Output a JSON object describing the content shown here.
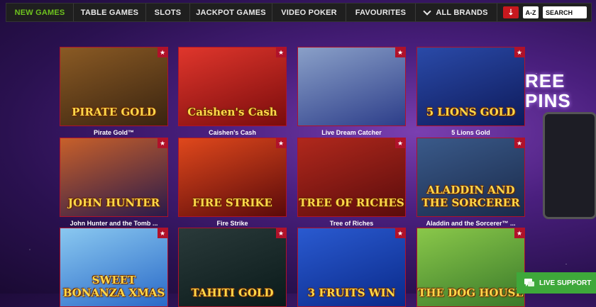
{
  "nav": {
    "items": [
      {
        "label": "NEW GAMES",
        "active": true
      },
      {
        "label": "TABLE GAMES",
        "active": false
      },
      {
        "label": "SLOTS",
        "active": false
      },
      {
        "label": "JACKPOT GAMES",
        "active": false
      },
      {
        "label": "VIDEO POKER",
        "active": false
      },
      {
        "label": "FAVOURITES",
        "active": false
      },
      {
        "label": "ALL BRANDS",
        "active": false
      }
    ],
    "sort_label": "A-Z",
    "search_placeholder": "SEARCH"
  },
  "promo": {
    "line1": "REE",
    "line2": "PINS"
  },
  "games": [
    {
      "caption": "Pirate Gold™",
      "art_title": "PIRATE GOLD",
      "bg": [
        "#3a2410",
        "#8a5a24"
      ]
    },
    {
      "caption": "Caishen's Cash",
      "art_title": "Caishen's Cash",
      "bg": [
        "#7a0c0c",
        "#e0362c"
      ]
    },
    {
      "caption": "Live Dream Catcher",
      "art_title": "",
      "bg": [
        "#2d3e8a",
        "#8aa0c8"
      ]
    },
    {
      "caption": "5 Lions Gold",
      "art_title": "5 LIONS GOLD",
      "bg": [
        "#0e1a5a",
        "#2a4aa8"
      ]
    },
    {
      "caption": "John Hunter and the Tomb ...",
      "art_title": "JOHN HUNTER",
      "bg": [
        "#2a1a4a",
        "#c8602a"
      ]
    },
    {
      "caption": "Fire Strike",
      "art_title": "FIRE STRIKE",
      "bg": [
        "#5a0a0a",
        "#e0481c"
      ]
    },
    {
      "caption": "Tree of Riches",
      "art_title": "TREE OF RICHES",
      "bg": [
        "#5a0c0c",
        "#b0281c"
      ]
    },
    {
      "caption": "Aladdin and the Sorcerer™ ...",
      "art_title": "ALADDIN AND THE SORCERER",
      "bg": [
        "#1a2a4a",
        "#3a5a8a"
      ]
    },
    {
      "caption": "",
      "art_title": "SWEET BONANZA XMAS",
      "bg": [
        "#2a6ac8",
        "#8ac8f0"
      ]
    },
    {
      "caption": "",
      "art_title": "TAHITI GOLD",
      "bg": [
        "#0a1a1a",
        "#2a3a3a"
      ]
    },
    {
      "caption": "",
      "art_title": "3 FRUITS WIN",
      "bg": [
        "#0a2a8a",
        "#2a5ad0"
      ]
    },
    {
      "caption": "",
      "art_title": "THE DOG HOUSE",
      "bg": [
        "#3a7a2a",
        "#8ac84a"
      ]
    }
  ],
  "support": {
    "label": "LIVE SUPPORT"
  }
}
